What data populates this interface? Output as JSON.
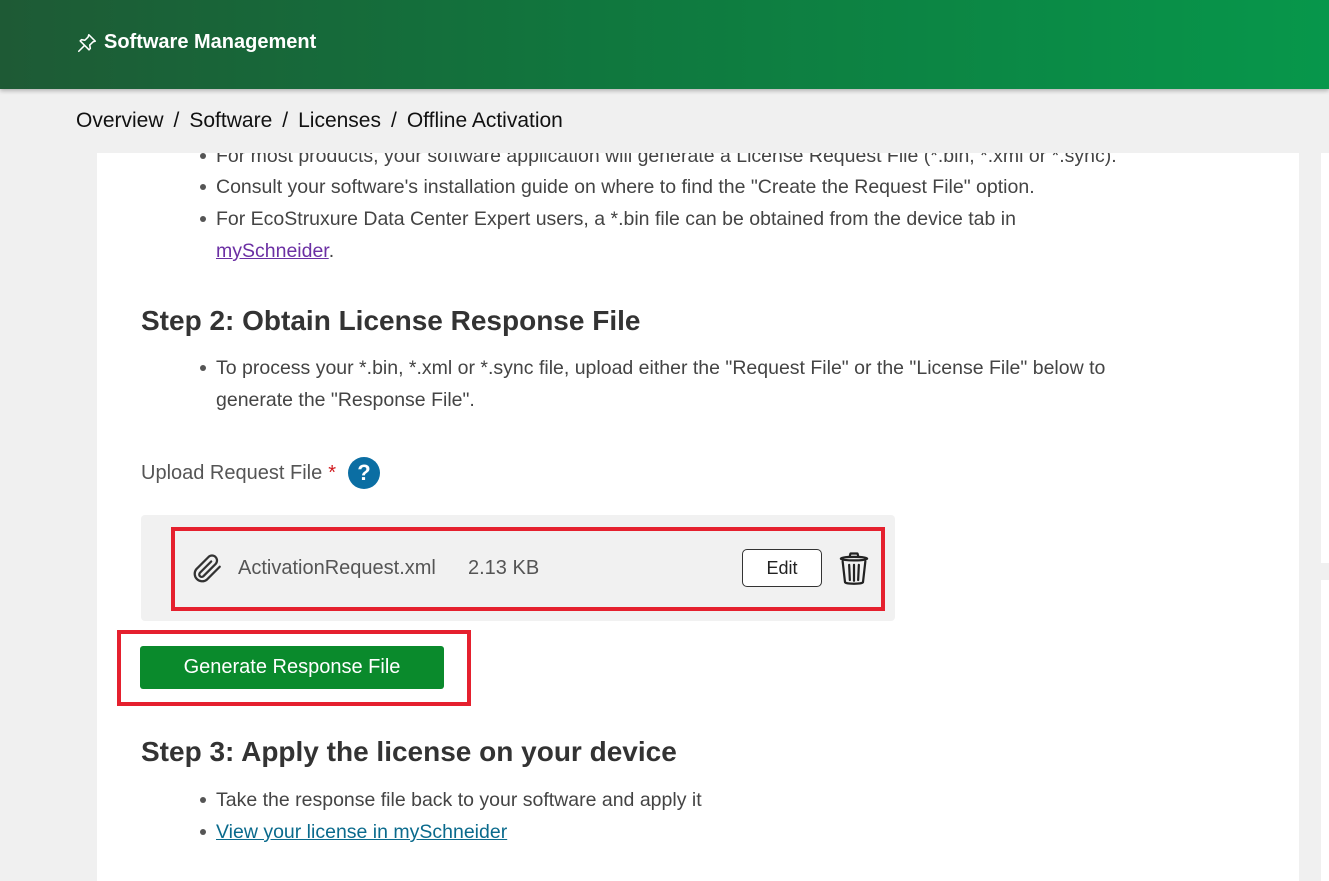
{
  "header": {
    "title": "Software Management",
    "icon": "pin-icon"
  },
  "breadcrumb": {
    "items": [
      "Overview",
      "Software",
      "Licenses",
      "Offline Activation"
    ],
    "separator": "/"
  },
  "step1": {
    "bullets": [
      "For most products, your software application will generate a License Request File (*.bin, *.xml or *.sync).",
      "Consult your software's installation guide on where to find the \"Create the Request File\" option.",
      "For EcoStruxure Data Center Expert users, a *.bin file can be obtained from the device tab in"
    ],
    "link_text": "mySchneider",
    "link_suffix": "."
  },
  "step2": {
    "heading": "Step 2: Obtain License Response File",
    "bullet_line1": "To process your *.bin, *.xml or *.sync file, upload either the \"Request File\" or the \"License File\" below to",
    "bullet_line2": "generate the \"Response File\".",
    "upload_label": "Upload Request File",
    "required_marker": "*",
    "help_glyph": "?",
    "file": {
      "name": "ActivationRequest.xml",
      "size": "2.13 KB"
    },
    "edit_label": "Edit",
    "generate_label": "Generate Response File"
  },
  "step3": {
    "heading": "Step 3: Apply the license on your device",
    "bullet": "Take the response file back to your software and apply it",
    "link_text": "View your license in mySchneider"
  },
  "colors": {
    "header_start": "#1e5a35",
    "header_end": "#07974b",
    "primary_button": "#0a8a2c",
    "highlight_border": "#e5202e",
    "help_icon": "#0b6ea3",
    "link_purple": "#6b2fa3",
    "link_teal": "#0a6a8c"
  }
}
